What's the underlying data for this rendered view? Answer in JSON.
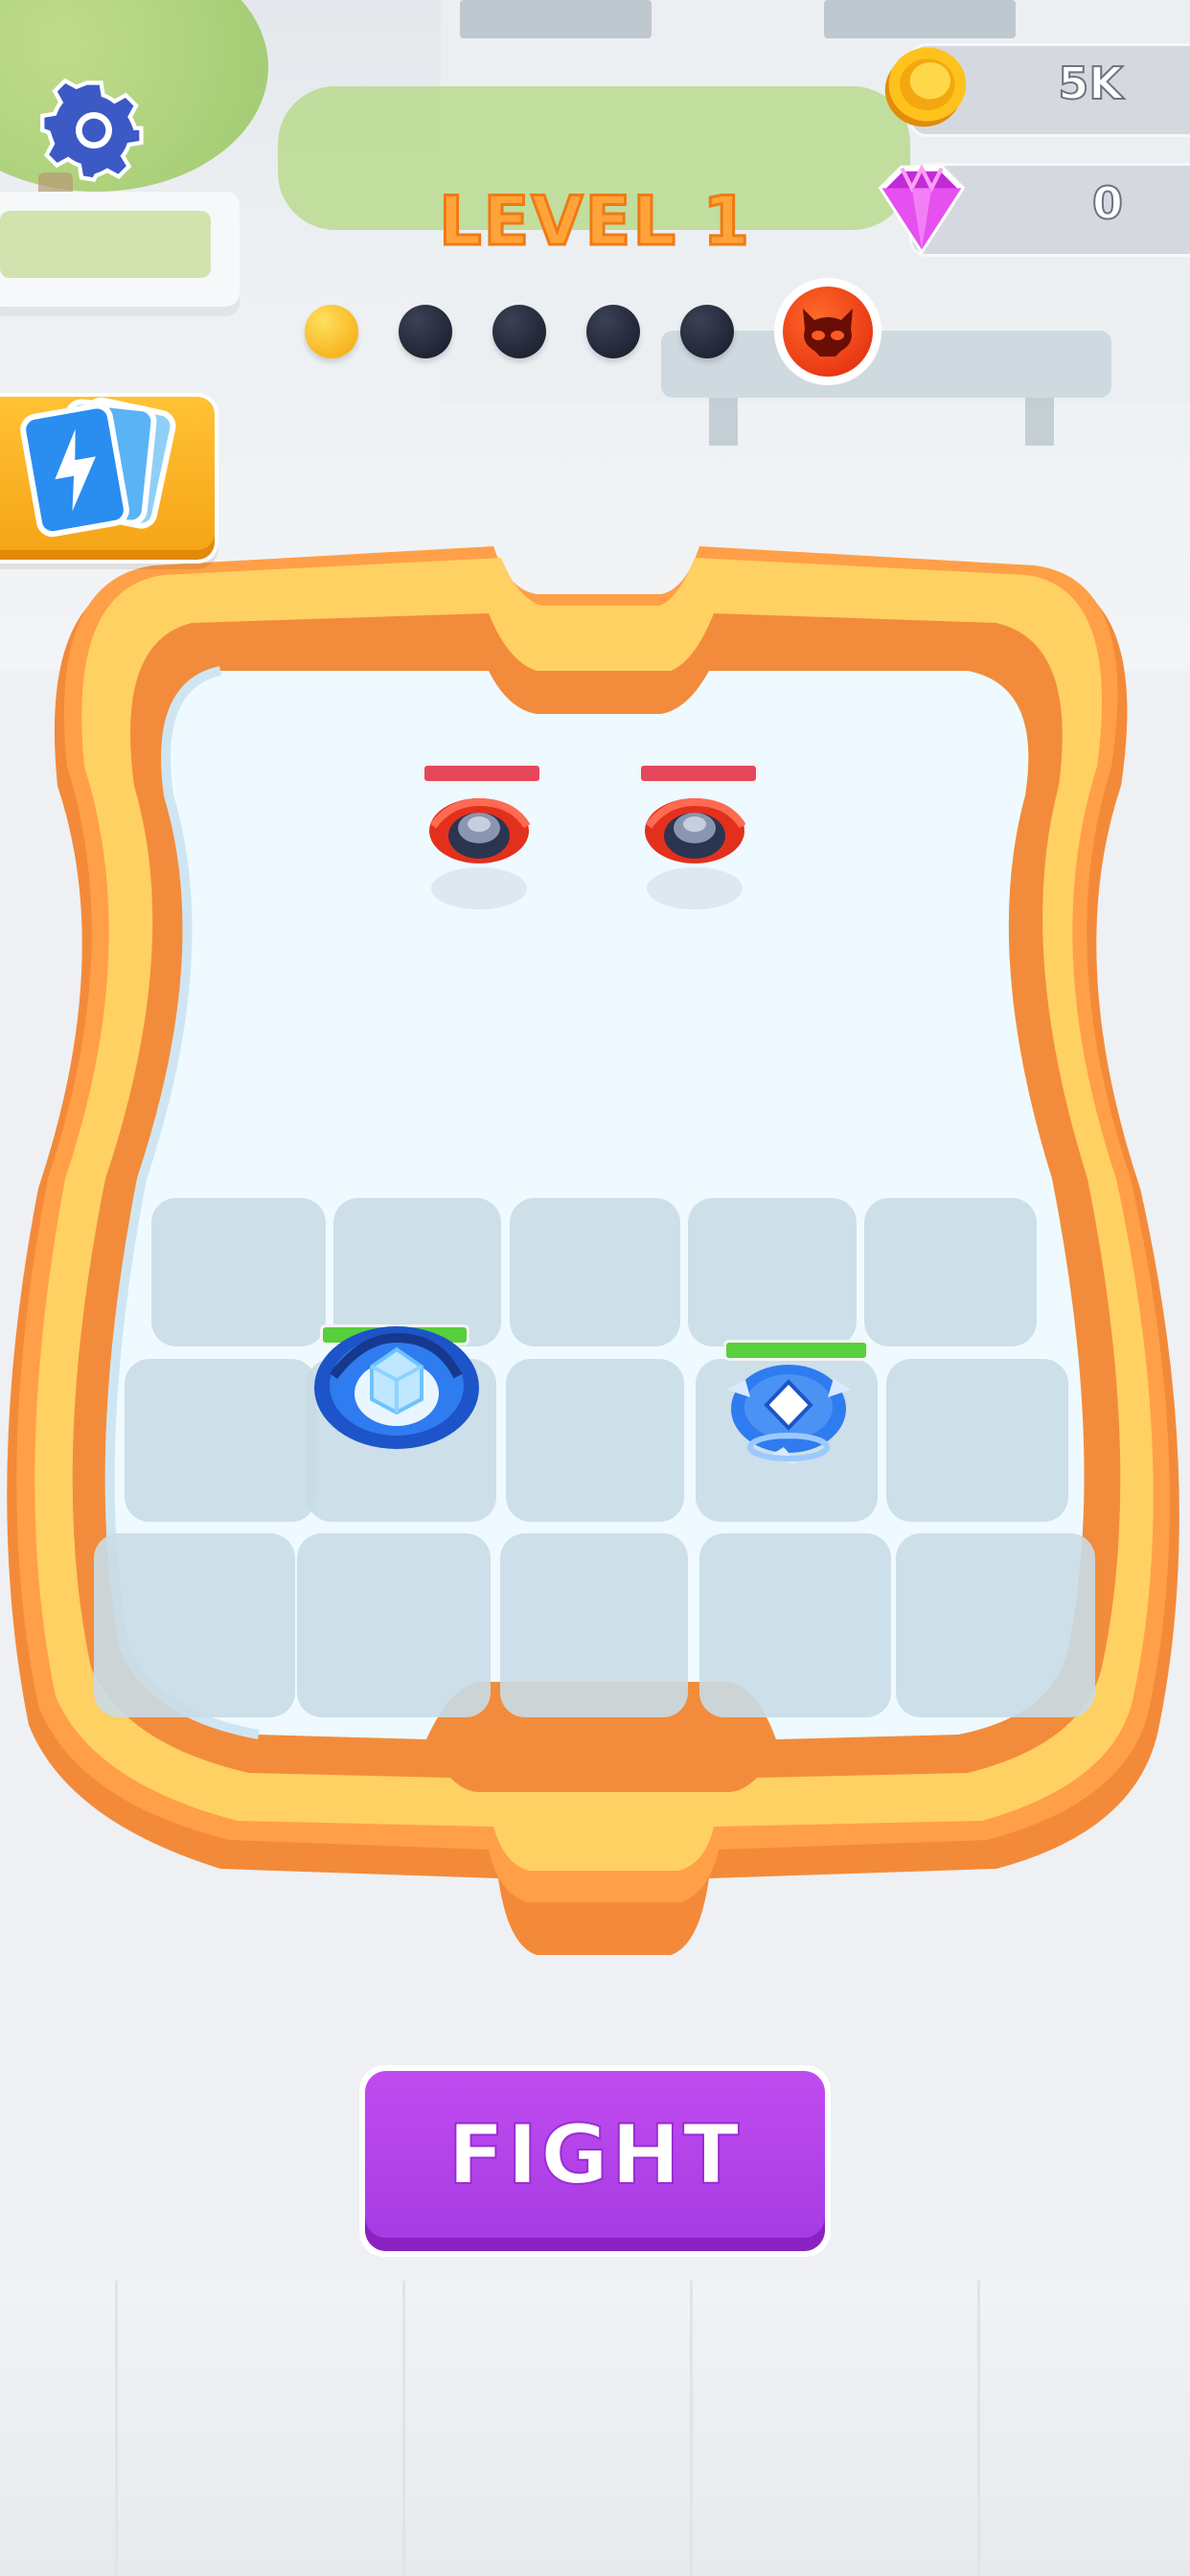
{
  "hud": {
    "coins_value": "5K",
    "gems_value": "0",
    "level_title": "LEVEL 1"
  },
  "progress": {
    "total_stages": 5,
    "completed_stages": 1,
    "boss_icon": "demon-skull-icon"
  },
  "fight_button": {
    "label": "FIGHT"
  },
  "arena": {
    "enemy_tops": 2,
    "player_tops": 2,
    "grid": {
      "rows": 3,
      "columns": 5
    }
  },
  "icons": {
    "settings": "gear-icon",
    "cards": "lightning-cards-icon",
    "coin": "coin-icon",
    "gem": "gem-icon"
  },
  "colors": {
    "accent_orange": "#ffa43a",
    "fight_purple": "#b043ea",
    "arena_rim": "#ffcf5c",
    "enemy_red": "#e5475a",
    "player_green": "#58cf3c"
  }
}
